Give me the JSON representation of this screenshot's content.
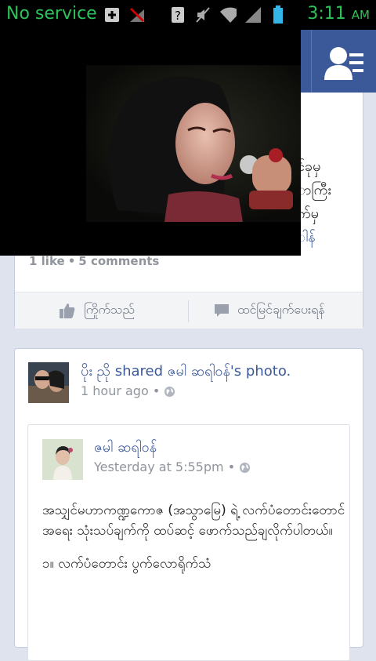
{
  "status_bar": {
    "carrier": "No service",
    "time": "3:11",
    "ampm": "AM",
    "icons": [
      "plus-box-icon",
      "no-signal-icon",
      "question-icon",
      "muted-icon",
      "wifi-icon",
      "signal-icon",
      "battery-icon"
    ],
    "accent": "#2dc35a"
  },
  "app_bar": {
    "color": "#3b5998",
    "right_icon": "friends-list-icon"
  },
  "card1": {
    "text_lines": [
      "င်ခုမှ",
      "ာကြီး",
      "က်မှ",
      "ါန်"
    ],
    "stats": {
      "likes": "1 like",
      "dot": "•",
      "comments": "5 comments"
    },
    "like_label": "ကြိုက်သည်",
    "comment_label": "ထင်မြင်ချက်ပေးရန်"
  },
  "card2": {
    "actor": "ပိုး ညို",
    "shared_text": "shared",
    "original": "ဇမါ ဆရါဝန်'s photo",
    "period": ".",
    "time": "1 hour ago",
    "dot": "•",
    "inner": {
      "name": "ဇမါ ဆရါဝန်",
      "time": "Yesterday at 5:55pm",
      "dot": "•",
      "paragraphs": [
        "အသျှင်မဟာကဏ္ဍကောဇ (အသွာမြေ) ရဲ့ လက်ပံတောင်းတောင်အရေး သုံးသပ်ချက်ကို ထပ်ဆင့် ဖောက်သည်ချလိုက်ပါတယ်။",
        "၁။ လက်ပံတောင်း ပွက်လောရိုက်သံ"
      ]
    }
  }
}
